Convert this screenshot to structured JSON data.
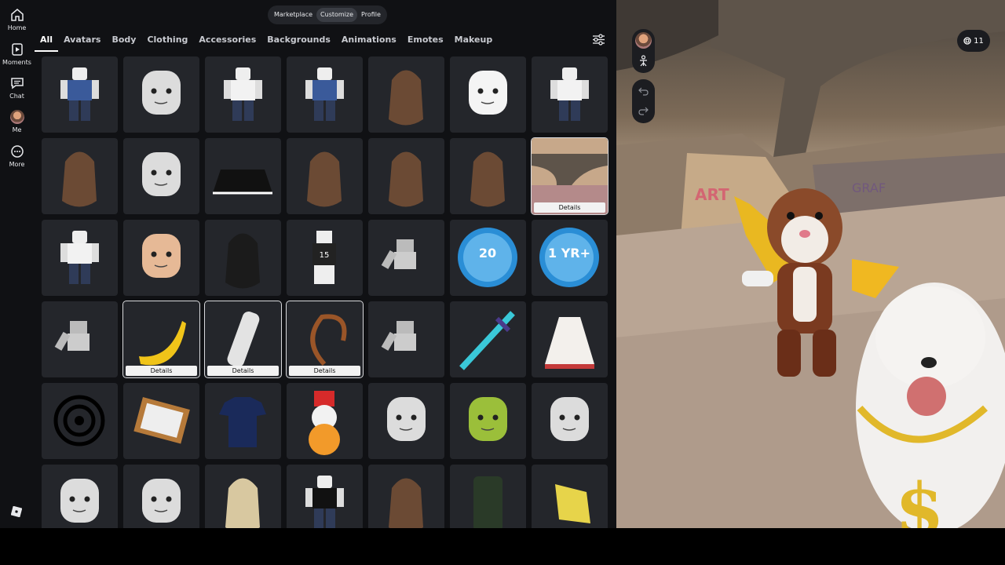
{
  "nav": {
    "items": [
      {
        "label": "Home",
        "icon": "home-icon"
      },
      {
        "label": "Moments",
        "icon": "moments-icon"
      },
      {
        "label": "Chat",
        "icon": "chat-icon"
      },
      {
        "label": "Me",
        "icon": "avatar"
      },
      {
        "label": "More",
        "icon": "more-icon"
      }
    ]
  },
  "top_tabs": [
    "Marketplace",
    "Customize",
    "Profile"
  ],
  "top_tabs_active": "Customize",
  "categories": [
    "All",
    "Avatars",
    "Body",
    "Clothing",
    "Accessories",
    "Backgrounds",
    "Animations",
    "Emotes",
    "Makeup"
  ],
  "categories_active": "All",
  "grid": {
    "details_label": "Details",
    "items": [
      {
        "name": "avatar-jacket-jeans"
      },
      {
        "name": "face-smirk"
      },
      {
        "name": "avatar-white-shirt"
      },
      {
        "name": "avatar-blue-vest"
      },
      {
        "name": "hair-bun-brown"
      },
      {
        "name": "face-pale-mask"
      },
      {
        "name": "avatar-white-girl"
      },
      {
        "name": "hair-long-brown"
      },
      {
        "name": "face-anime-eyes"
      },
      {
        "name": "skirt-black-white"
      },
      {
        "name": "hair-wavy-brown"
      },
      {
        "name": "hair-straight-brown"
      },
      {
        "name": "hair-back-brown"
      },
      {
        "name": "background-skatepark",
        "details": true
      },
      {
        "name": "shirt-striped-avatar"
      },
      {
        "name": "face-anime-skin"
      },
      {
        "name": "hair-long-black"
      },
      {
        "name": "jersey-15"
      },
      {
        "name": "animation-pose-1"
      },
      {
        "name": "badge-20"
      },
      {
        "name": "badge-1-yr"
      },
      {
        "name": "animation-pose-2"
      },
      {
        "name": "banana",
        "details": true
      },
      {
        "name": "arm-bandage",
        "details": true
      },
      {
        "name": "tail-brown",
        "details": true
      },
      {
        "name": "animation-pose-3"
      },
      {
        "name": "sword-blue"
      },
      {
        "name": "dress-white-red"
      },
      {
        "name": "decal-spiral"
      },
      {
        "name": "frame-picture"
      },
      {
        "name": "tshirt-hunt"
      },
      {
        "name": "snowman-hat"
      },
      {
        "name": "head-pale"
      },
      {
        "name": "head-alien"
      },
      {
        "name": "face-angry"
      },
      {
        "name": "face-classic"
      },
      {
        "name": "head-bald"
      },
      {
        "name": "hair-blonde"
      },
      {
        "name": "shirt-black-white"
      },
      {
        "name": "hair-messy-brown"
      },
      {
        "name": "outfit-dark-green"
      },
      {
        "name": "accessory-yellow"
      }
    ]
  },
  "wallet": {
    "robux": "11"
  },
  "colors": {
    "accent": "#ffffff",
    "panel": "#24262b",
    "background": "#101114"
  }
}
